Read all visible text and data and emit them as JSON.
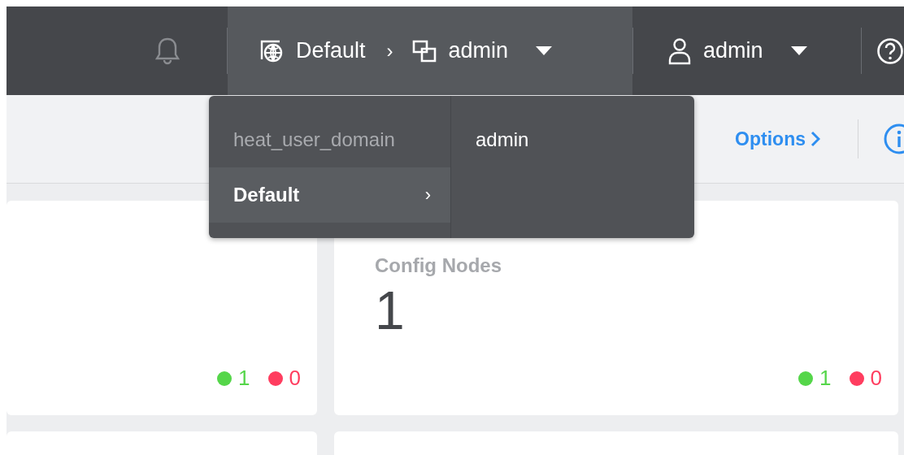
{
  "top_bar": {
    "scope": {
      "domain": "Default",
      "separator": "›",
      "project": "admin"
    },
    "user": {
      "name": "admin"
    }
  },
  "sub_header": {
    "link": "Options"
  },
  "scope_menu": {
    "domains": [
      {
        "label": "heat_user_domain",
        "selected": false
      },
      {
        "label": "Default",
        "selected": true,
        "chevron": "›"
      }
    ],
    "projects": [
      {
        "label": "admin"
      }
    ]
  },
  "cards": [
    {
      "status": [
        {
          "count": "1",
          "color": "#55d64a"
        },
        {
          "count": "0",
          "color": "#ff3d5f"
        }
      ]
    },
    {
      "title": "Config Nodes",
      "value": "1",
      "status": [
        {
          "count": "1",
          "color": "#55d64a"
        },
        {
          "count": "0",
          "color": "#ff3d5f"
        }
      ]
    }
  ]
}
